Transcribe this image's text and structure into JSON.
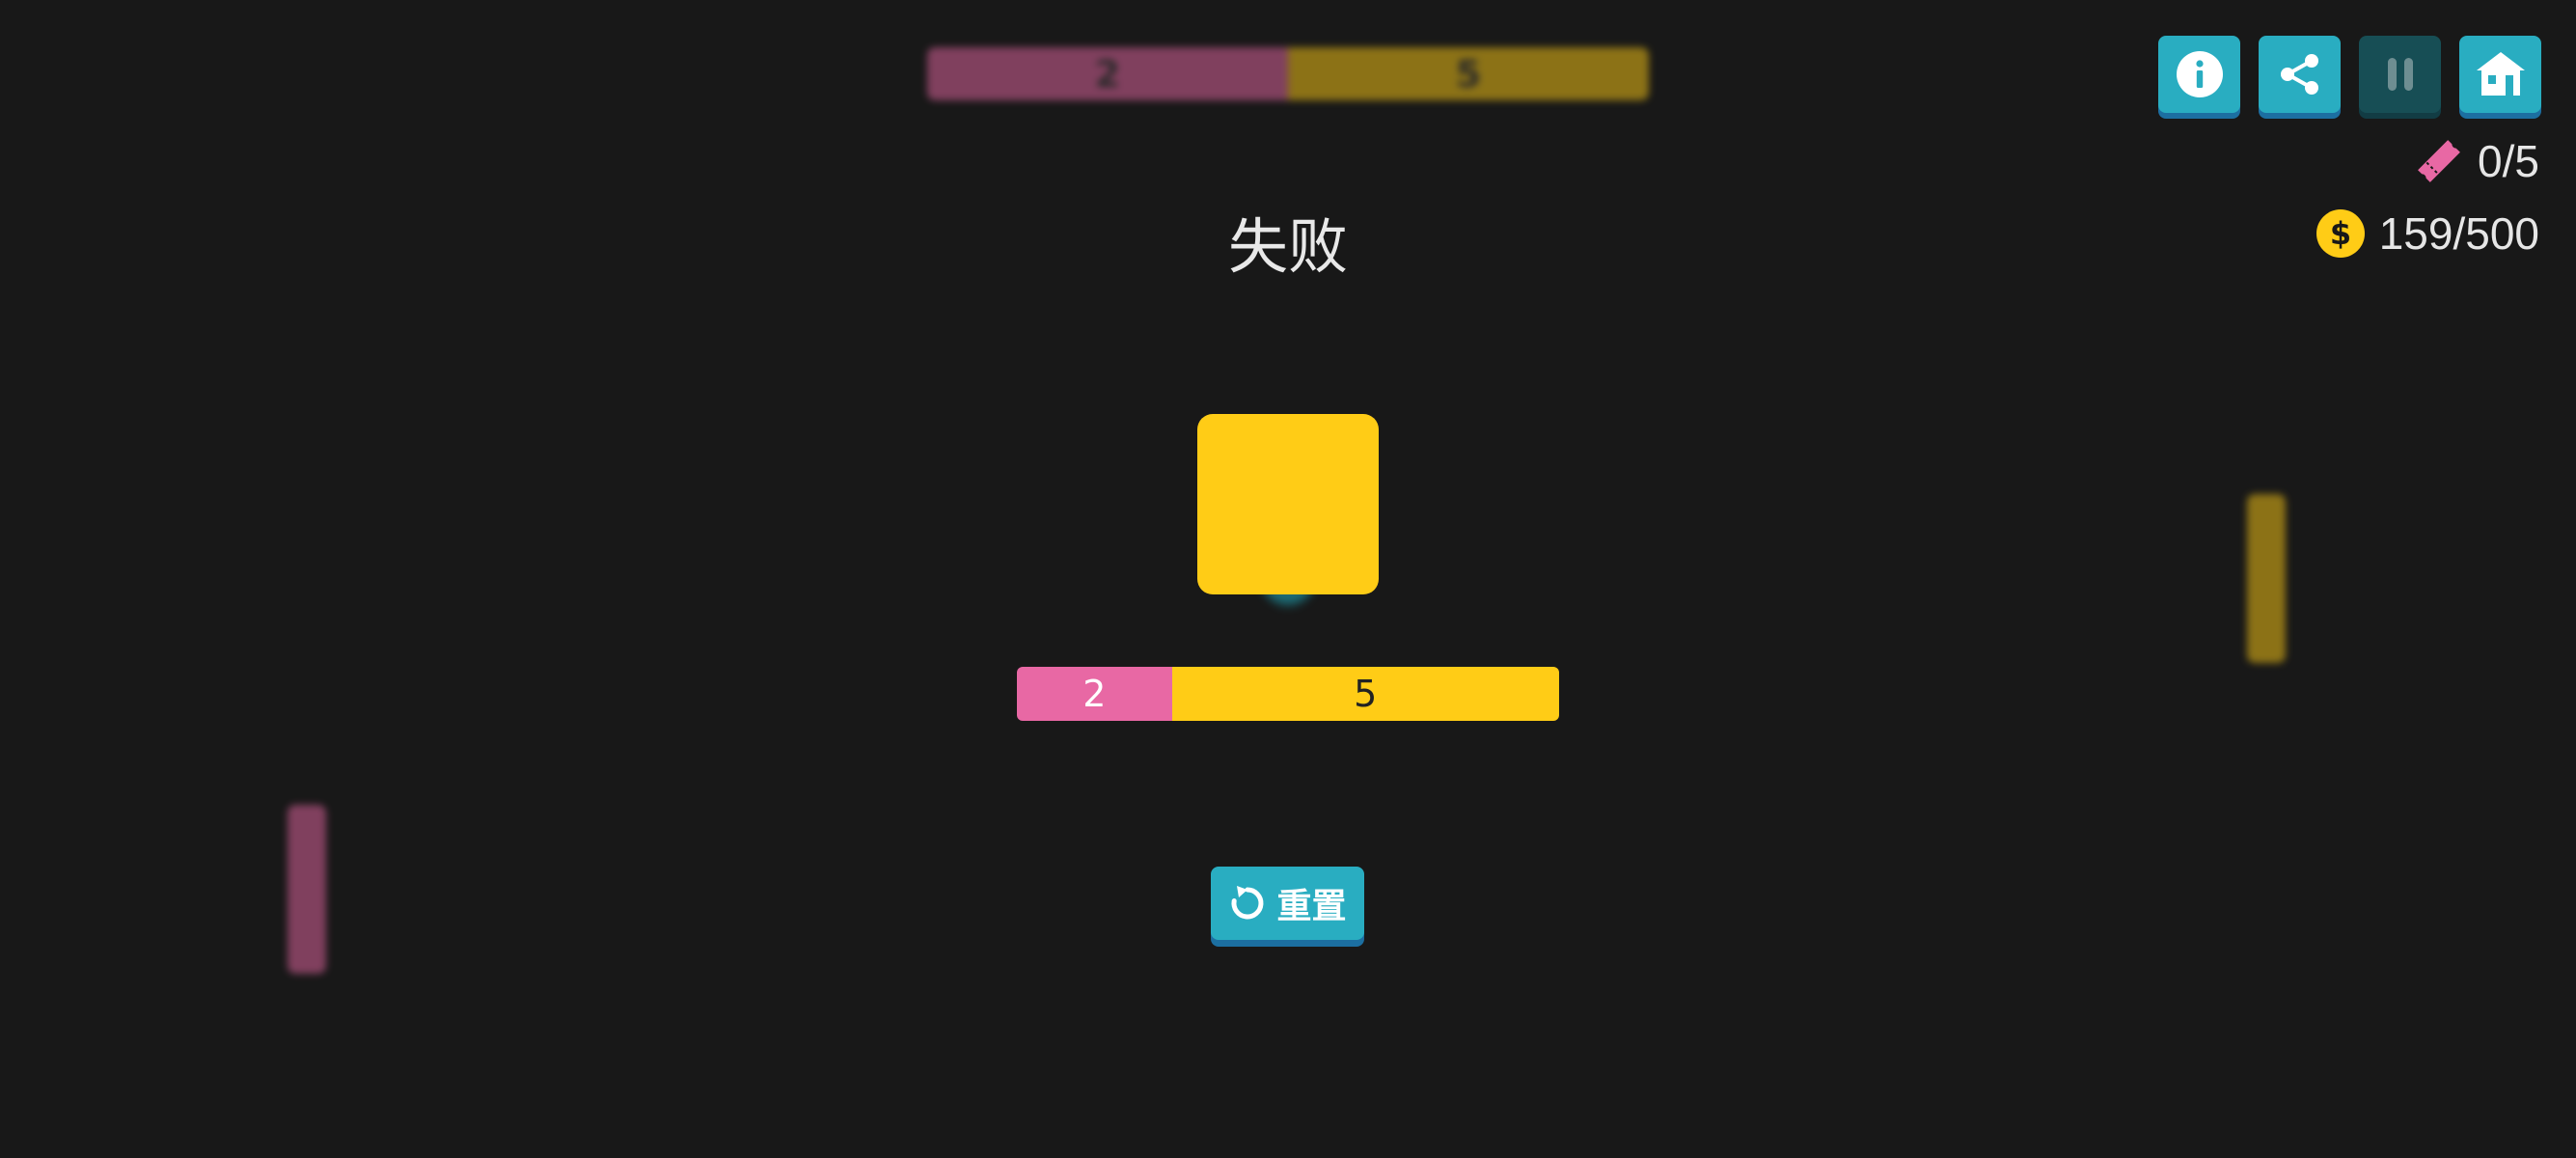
{
  "colors": {
    "pink": "#e868a4",
    "yellow": "#ffcc16",
    "teal": "#29adc1"
  },
  "background": {
    "score_bar": {
      "pink_score": "2",
      "yellow_score": "5"
    }
  },
  "toolbar": {
    "info_icon": "info-icon",
    "share_icon": "share-icon",
    "pause_icon": "pause-icon",
    "home_icon": "home-icon"
  },
  "counters": {
    "tickets": "0/5",
    "coins": "159/500"
  },
  "result": {
    "title": "失败",
    "pink_score": "2",
    "yellow_score": "5",
    "pink_share": 0.2857,
    "yellow_share": 0.7143,
    "reset_label": "重置"
  }
}
